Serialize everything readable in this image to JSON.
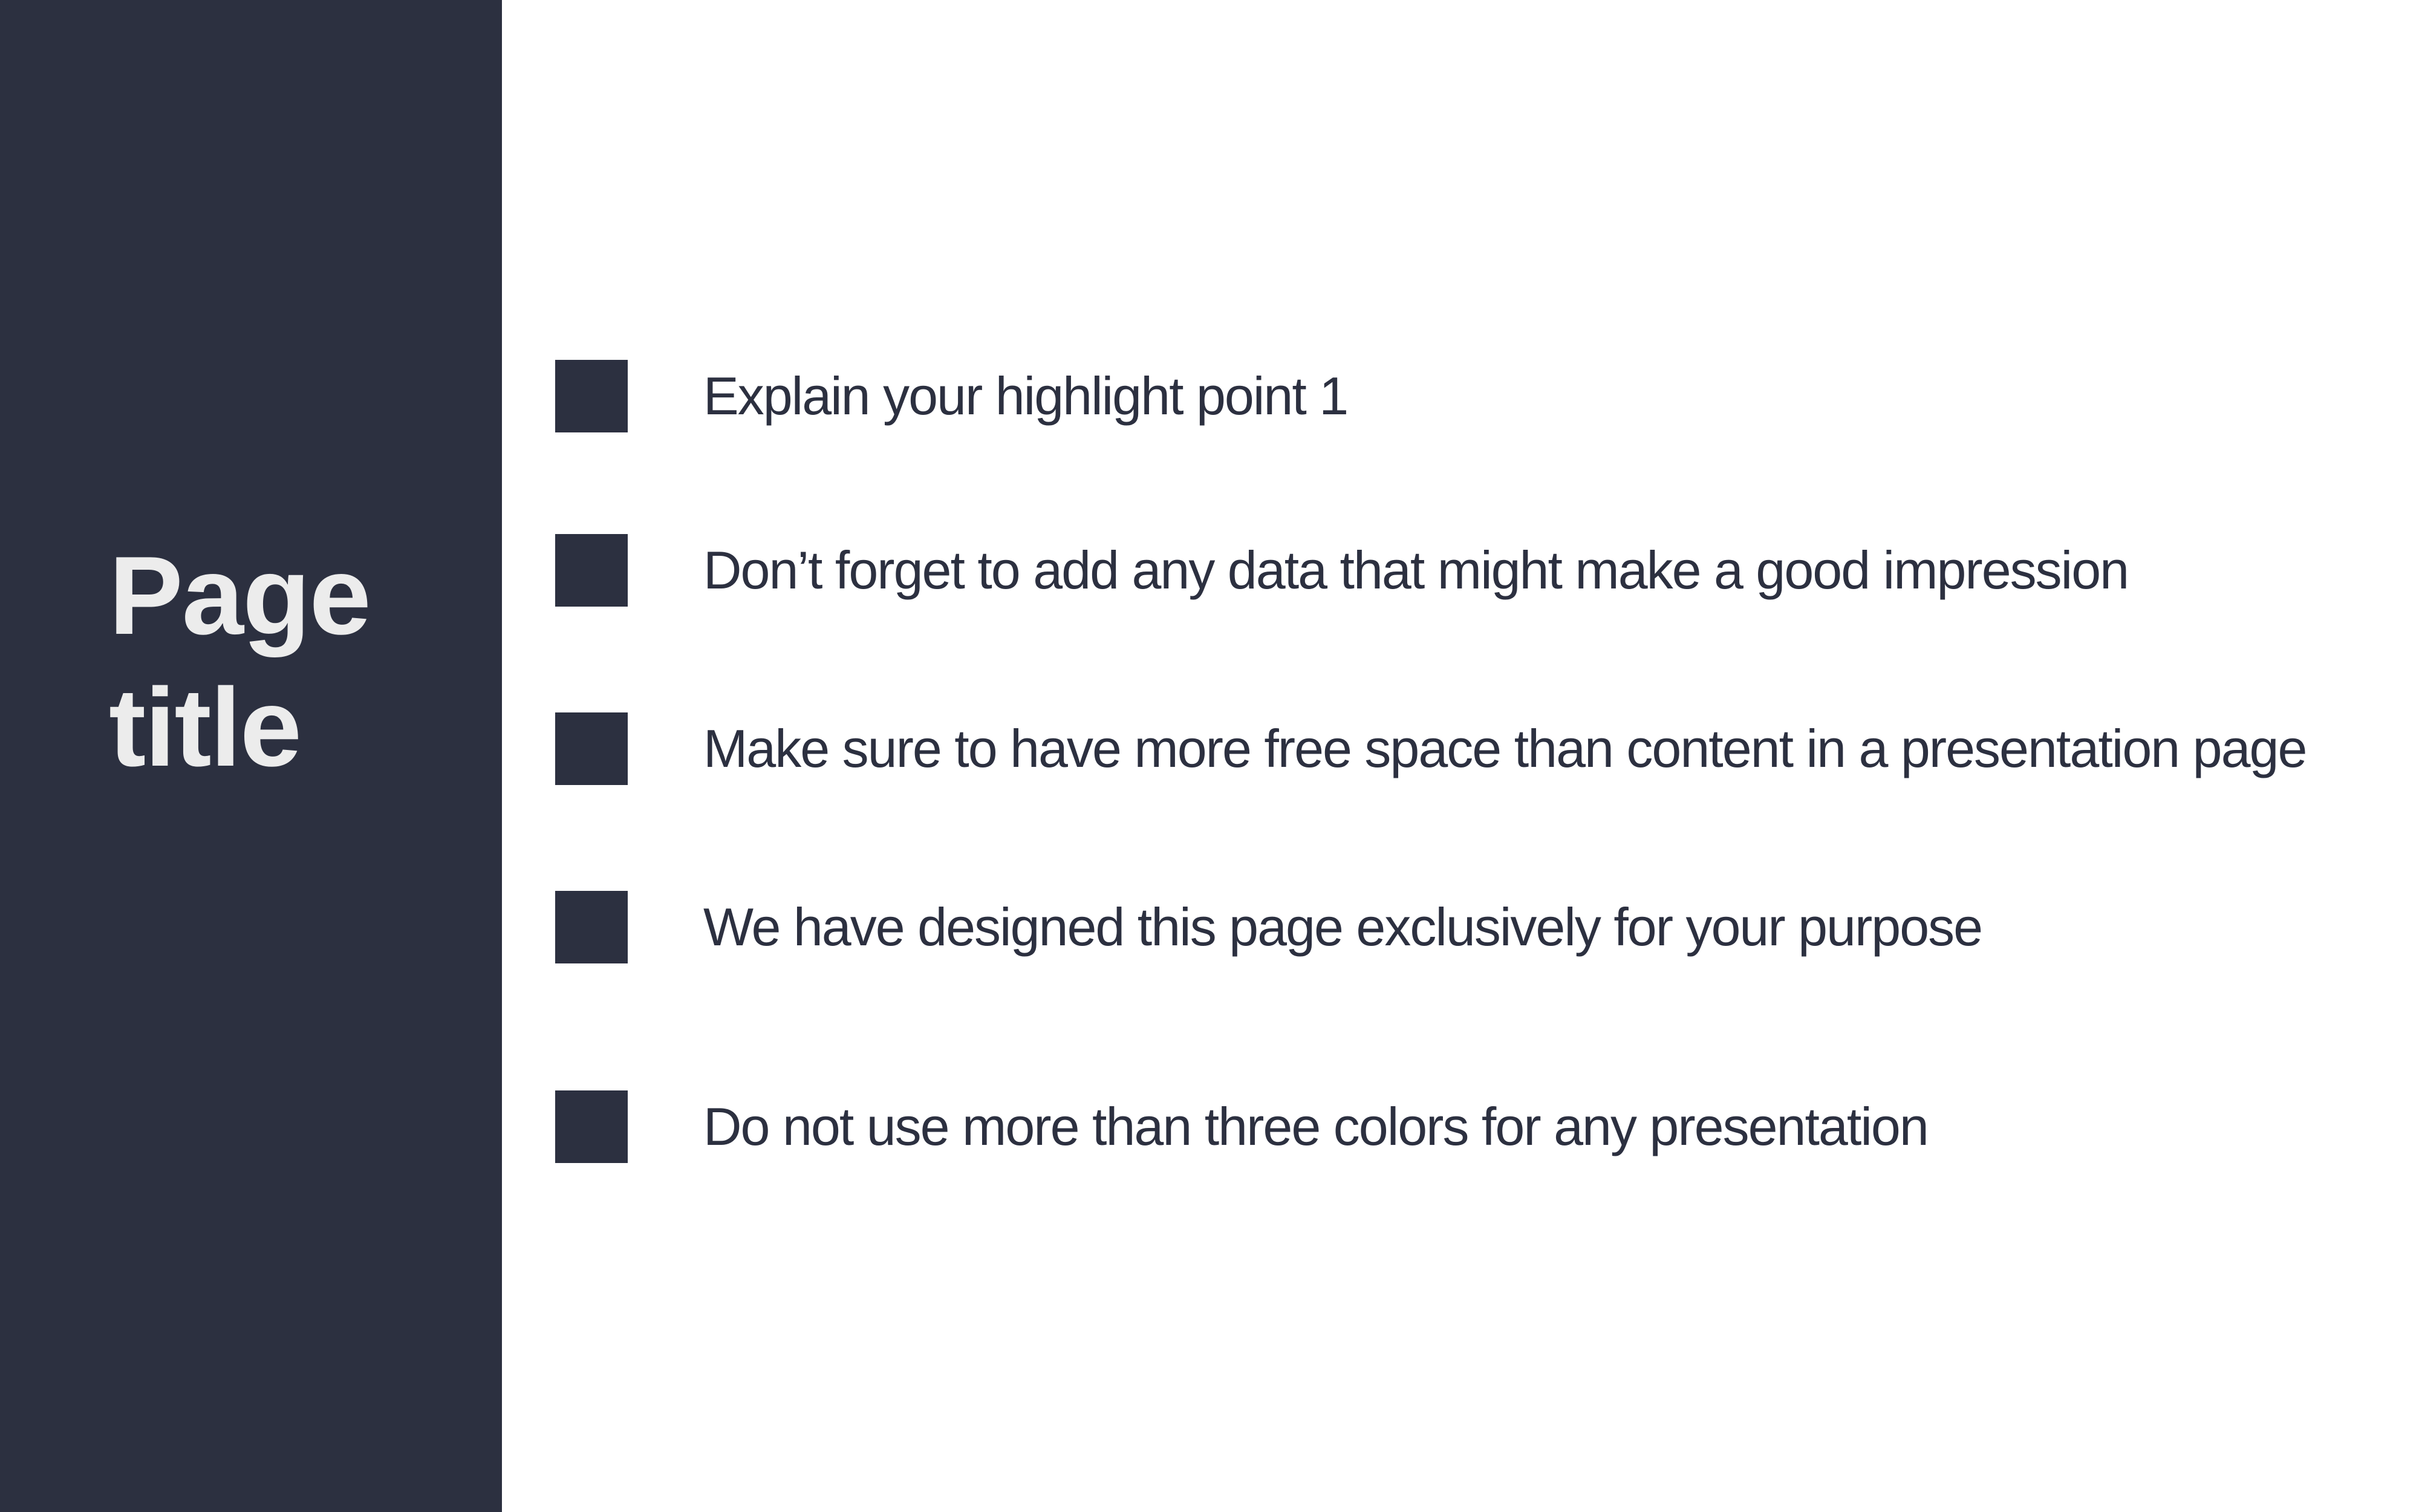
{
  "slide": {
    "title": "Page title",
    "colors": {
      "dark": "#2c3040",
      "light": "#ffffff",
      "title_text": "#ececec"
    },
    "bullet_icon": "square-bullet-icon",
    "bullets": [
      "Explain your highlight point 1",
      "Don’t forget to add any data that might make a good impression",
      "Make sure to have more free space than content in a presentation page",
      "We have designed this page exclusively for your purpose",
      "Do not use more than three colors for any presentation"
    ]
  }
}
